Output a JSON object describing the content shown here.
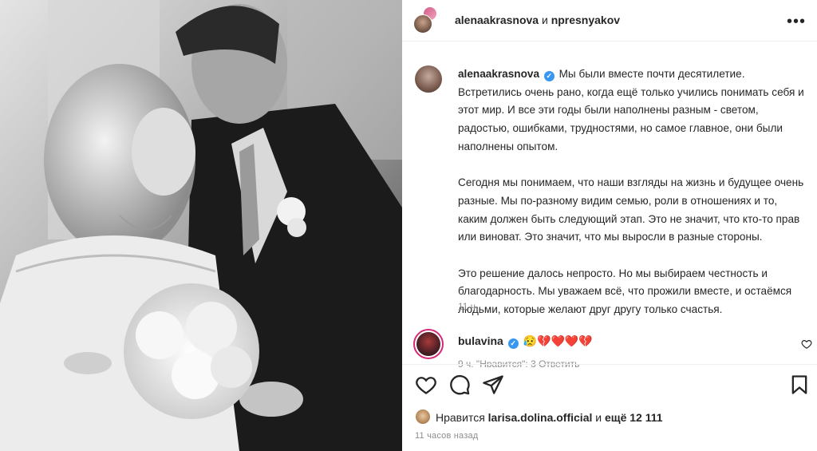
{
  "header": {
    "user1": "alenaakrasnova",
    "conj": "и",
    "user2": "npresnyakov",
    "more": "•••"
  },
  "caption": {
    "username": "alenaakrasnova",
    "verified": true,
    "para1": "Мы были вместе почти десятилетие. Встретились очень рано, когда ещё только учились понимать себя и этот мир. И все эти годы были наполнены разным - светом, радостью, ошибками, трудностями, но самое главное, они были наполнены опытом.",
    "para2": "Сегодня мы понимаем, что наши взгляды на жизнь и будущее очень разные. Мы по-разному видим семью, роли в отношениях и то, каким должен быть следующий этап. Это не значит, что кто-то прав или виноват. Это значит, что мы выросли в разные стороны.",
    "para3": "Это решение далось непросто. Но мы выбираем честность и благодарность. Мы уважаем всё, что прожили вместе, и остаёмся людьми, которые желают друг другу только счастья.",
    "time": "11 ч."
  },
  "comment": {
    "username": "bulavina",
    "verified": true,
    "text": "😥💔❤️❤️💔",
    "meta": "9 ч.   \"Нравится\": 3   Ответить"
  },
  "likes": {
    "prefix": "Нравится",
    "user": "larisa.dolina.official",
    "and": "и",
    "rest": "ещё 12 111"
  },
  "posted": "11 часов назад",
  "colors": {
    "verified": "#3897f0",
    "text": "#262626",
    "muted": "#8e8e8e",
    "story_ring": "#d62976"
  },
  "icons": [
    "more-icon",
    "verified-icon",
    "heart-icon",
    "comment-icon",
    "share-icon",
    "bookmark-icon"
  ]
}
